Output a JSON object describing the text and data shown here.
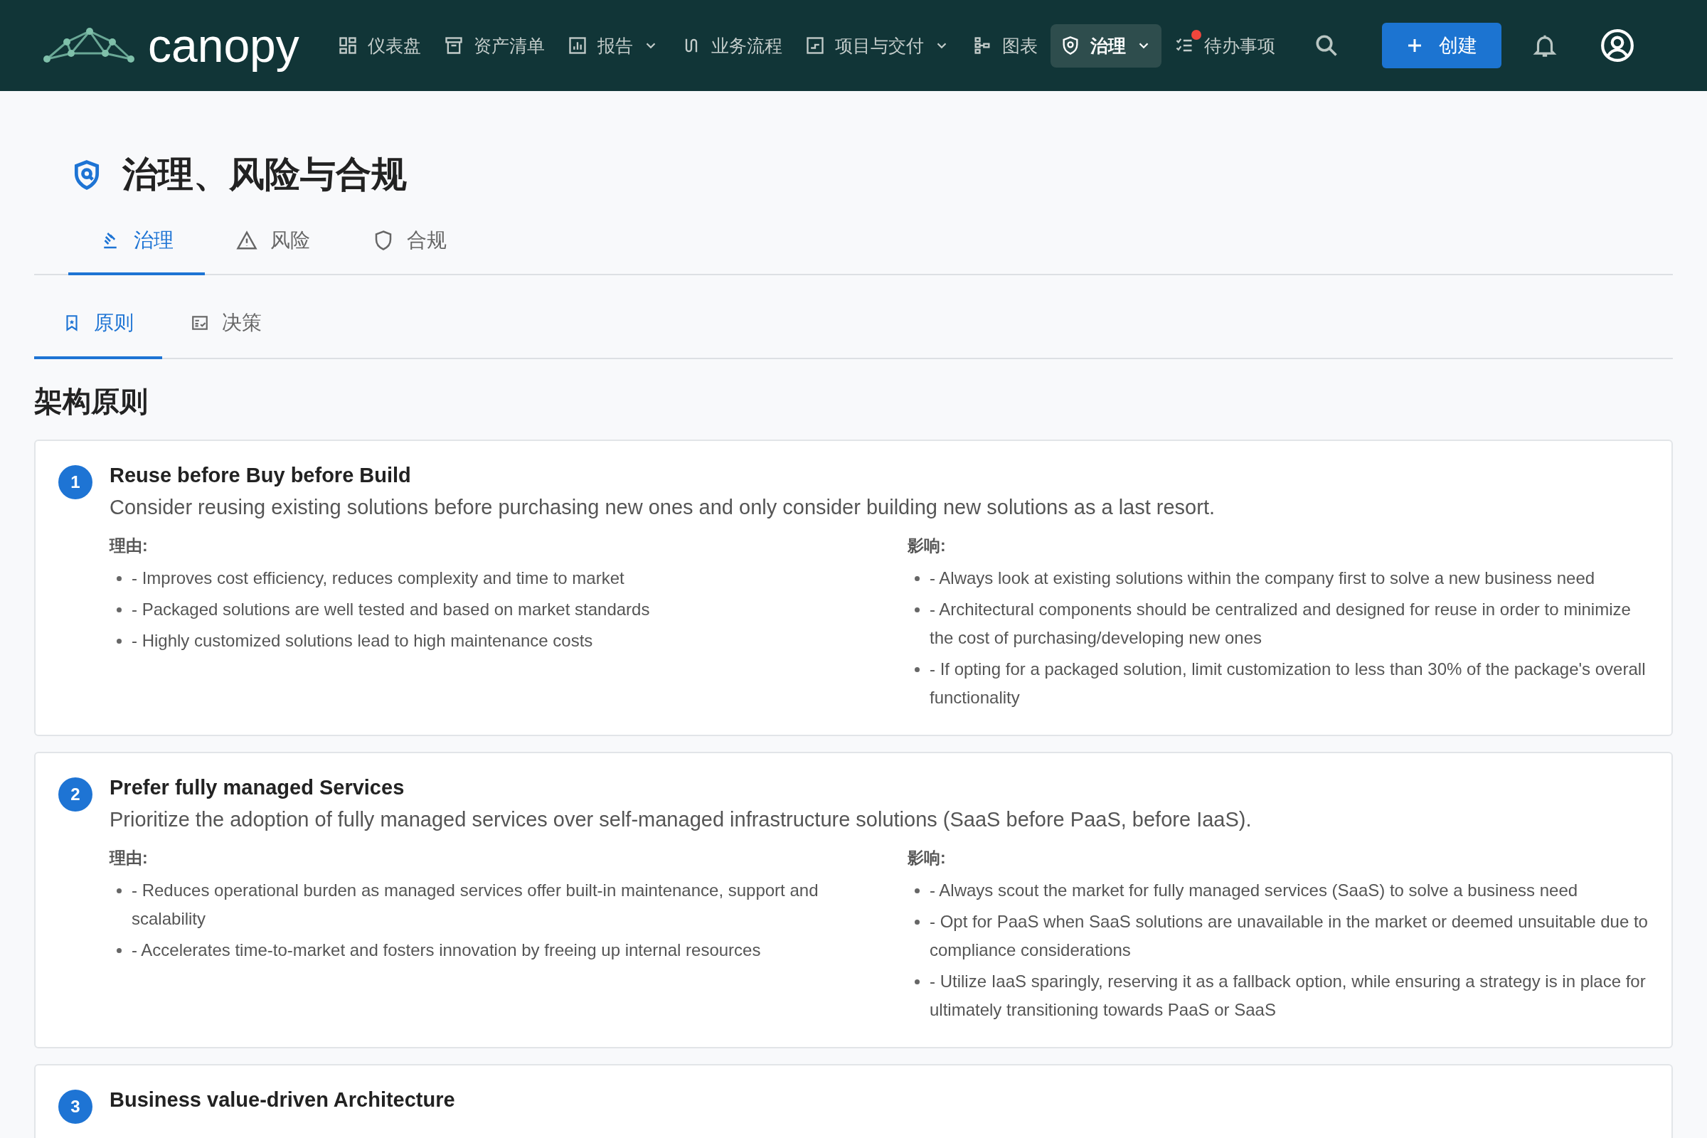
{
  "nav": {
    "logo": "canopy",
    "items": [
      {
        "label": "仪表盘",
        "selected": false,
        "dropdown": false,
        "alert": false
      },
      {
        "label": "资产清单",
        "selected": false,
        "dropdown": false,
        "alert": false
      },
      {
        "label": "报告",
        "selected": false,
        "dropdown": true,
        "alert": false
      },
      {
        "label": "业务流程",
        "selected": false,
        "dropdown": false,
        "alert": false
      },
      {
        "label": "项目与交付",
        "selected": false,
        "dropdown": true,
        "alert": false
      },
      {
        "label": "图表",
        "selected": false,
        "dropdown": false,
        "alert": false
      },
      {
        "label": "治理",
        "selected": true,
        "dropdown": true,
        "alert": false
      },
      {
        "label": "待办事项",
        "selected": false,
        "dropdown": false,
        "alert": true
      }
    ],
    "create_button": "创建"
  },
  "page_title": "治理、风险与合规",
  "tabs": [
    {
      "label": "治理",
      "selected": true
    },
    {
      "label": "风险",
      "selected": false
    },
    {
      "label": "合规",
      "selected": false
    }
  ],
  "subtabs": [
    {
      "label": "原则",
      "selected": true
    },
    {
      "label": "决策",
      "selected": false
    }
  ],
  "section_title": "架构原则",
  "principles": [
    {
      "number": "1",
      "title": "Reuse before Buy before Build",
      "description": "Consider reusing existing solutions before purchasing new ones and only consider building new solutions as a last resort.",
      "rationale_label": "理由:",
      "rationale": [
        "- Improves cost efficiency, reduces complexity and time to market",
        "- Packaged solutions are well tested and based on market standards",
        "- Highly customized solutions lead to high maintenance costs"
      ],
      "implications_label": "影响:",
      "implications": [
        "- Always look at existing solutions within the company first to solve a new business need",
        "- Architectural components should be centralized and designed for reuse in order to minimize the cost of purchasing/developing new ones",
        "- If opting for a packaged solution, limit customization to less than 30% of the package's overall functionality"
      ]
    },
    {
      "number": "2",
      "title": "Prefer fully managed Services",
      "description": "Prioritize the adoption of fully managed services over self-managed infrastructure solutions (SaaS before PaaS, before IaaS).",
      "rationale_label": "理由:",
      "rationale": [
        "- Reduces operational burden as managed services offer built-in maintenance, support and scalability",
        "- Accelerates time-to-market and fosters innovation by freeing up internal resources"
      ],
      "implications_label": "影响:",
      "implications": [
        "- Always scout the market for fully managed services (SaaS) to solve a business need",
        "- Opt for PaaS when SaaS solutions are unavailable in the market or deemed unsuitable due to compliance considerations",
        "- Utilize IaaS sparingly, reserving it as a fallback option, while ensuring a strategy is in place for ultimately transitioning towards PaaS or SaaS"
      ]
    },
    {
      "number": "3",
      "title": "Business value-driven Architecture"
    }
  ]
}
